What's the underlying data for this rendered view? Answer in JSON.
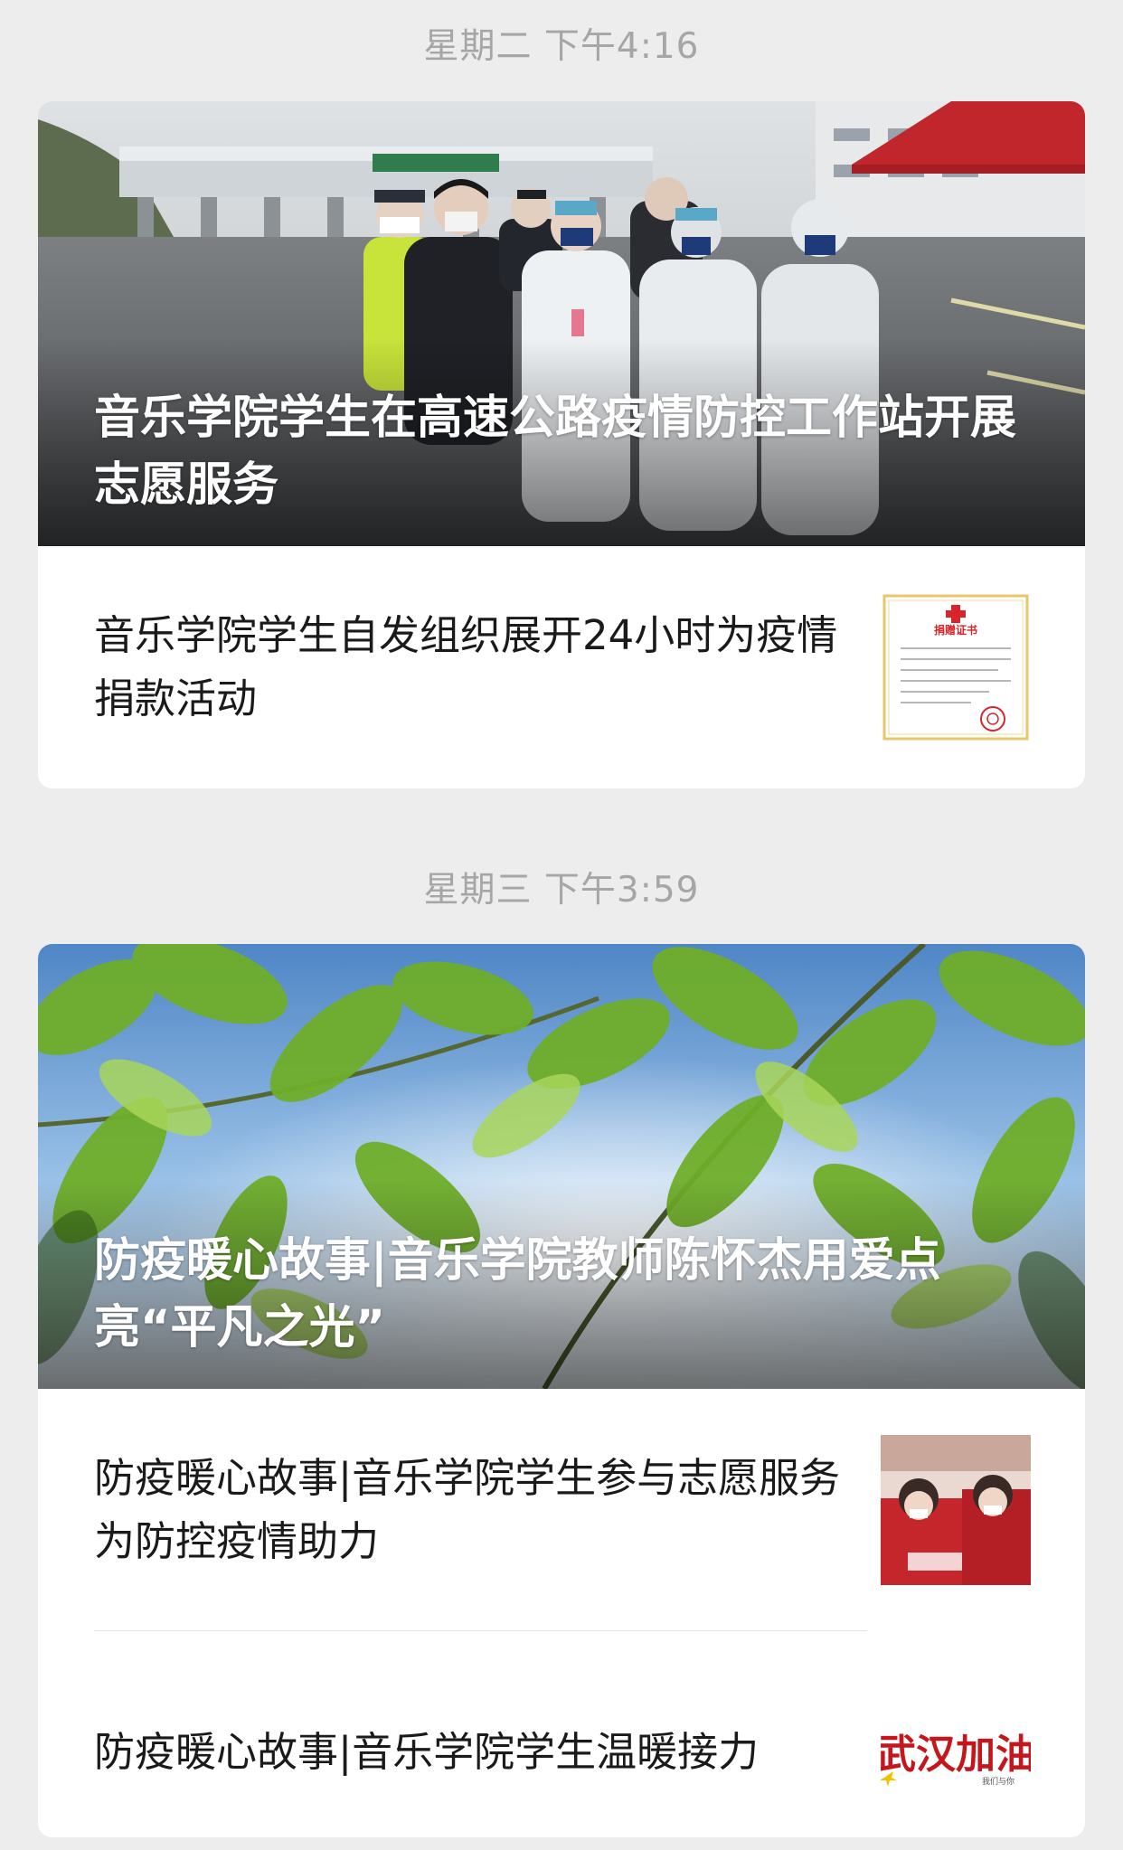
{
  "groups": [
    {
      "timestamp": "星期二 下午4:16",
      "hero_title": "音乐学院学生在高速公路疫情防控工作站开展志愿服务",
      "items": [
        {
          "title": "音乐学院学生自发组织展开24小时为疫情捐款活动",
          "thumb": "donation-certificate-image",
          "thumb_heading": "捐赠证书"
        }
      ]
    },
    {
      "timestamp": "星期三 下午3:59",
      "hero_title": "防疫暖心故事|音乐学院教师陈怀杰用爱点亮“平凡之光”",
      "items": [
        {
          "title": "防疫暖心故事|音乐学院学生参与志愿服务为防控疫情助力",
          "thumb": "volunteers-red-vests-image"
        },
        {
          "title": "防疫暖心故事|音乐学院学生温暖接力",
          "thumb": "wuhan-jiayou-calligraphy-image",
          "thumb_text": "武汉加油",
          "thumb_caption": "我们与你"
        }
      ]
    }
  ],
  "colors": {
    "background": "#ededed",
    "card": "#ffffff",
    "timestamp": "#a6a6a6",
    "text": "#1a1a1a"
  }
}
